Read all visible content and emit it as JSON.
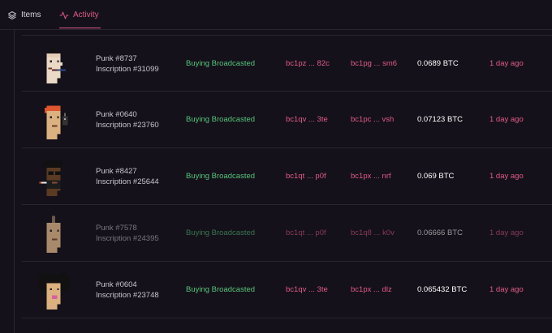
{
  "tabs": {
    "items": {
      "label": "Items",
      "icon": "layers-icon"
    },
    "activity": {
      "label": "Activity",
      "icon": "activity-icon",
      "active": true
    }
  },
  "colors": {
    "background": "#14111a",
    "accent": "#e35b88",
    "success": "#58c47a",
    "divider": "#2a2631"
  },
  "activity": {
    "rows": [
      {
        "name": "Punk #8737",
        "inscription": "Inscription #31099",
        "status": "Buying Broadcasted",
        "from": "bc1pz ... 82c",
        "to": "bc1pg ... sm6",
        "price": "0.0689 BTC",
        "time": "1 day ago"
      },
      {
        "name": "Punk #0640",
        "inscription": "Inscription #23760",
        "status": "Buying Broadcasted",
        "from": "bc1qv ... 3te",
        "to": "bc1pc ... vsh",
        "price": "0.07123 BTC",
        "time": "1 day ago"
      },
      {
        "name": "Punk #8427",
        "inscription": "Inscription #25644",
        "status": "Buying Broadcasted",
        "from": "bc1qt ... p0f",
        "to": "bc1px ... nrf",
        "price": "0.069 BTC",
        "time": "1 day ago"
      },
      {
        "name": "Punk #7578",
        "inscription": "Inscription #24395",
        "status": "Buying Broadcasted",
        "from": "bc1qt ... p0f",
        "to": "bc1q8 ... k0v",
        "price": "0.06666 BTC",
        "time": "1 day ago"
      },
      {
        "name": "Punk #0604",
        "inscription": "Inscription #23748",
        "status": "Buying Broadcasted",
        "from": "bc1qv ... 3te",
        "to": "bc1px ... dlz",
        "price": "0.065432 BTC",
        "time": "1 day ago"
      }
    ]
  }
}
